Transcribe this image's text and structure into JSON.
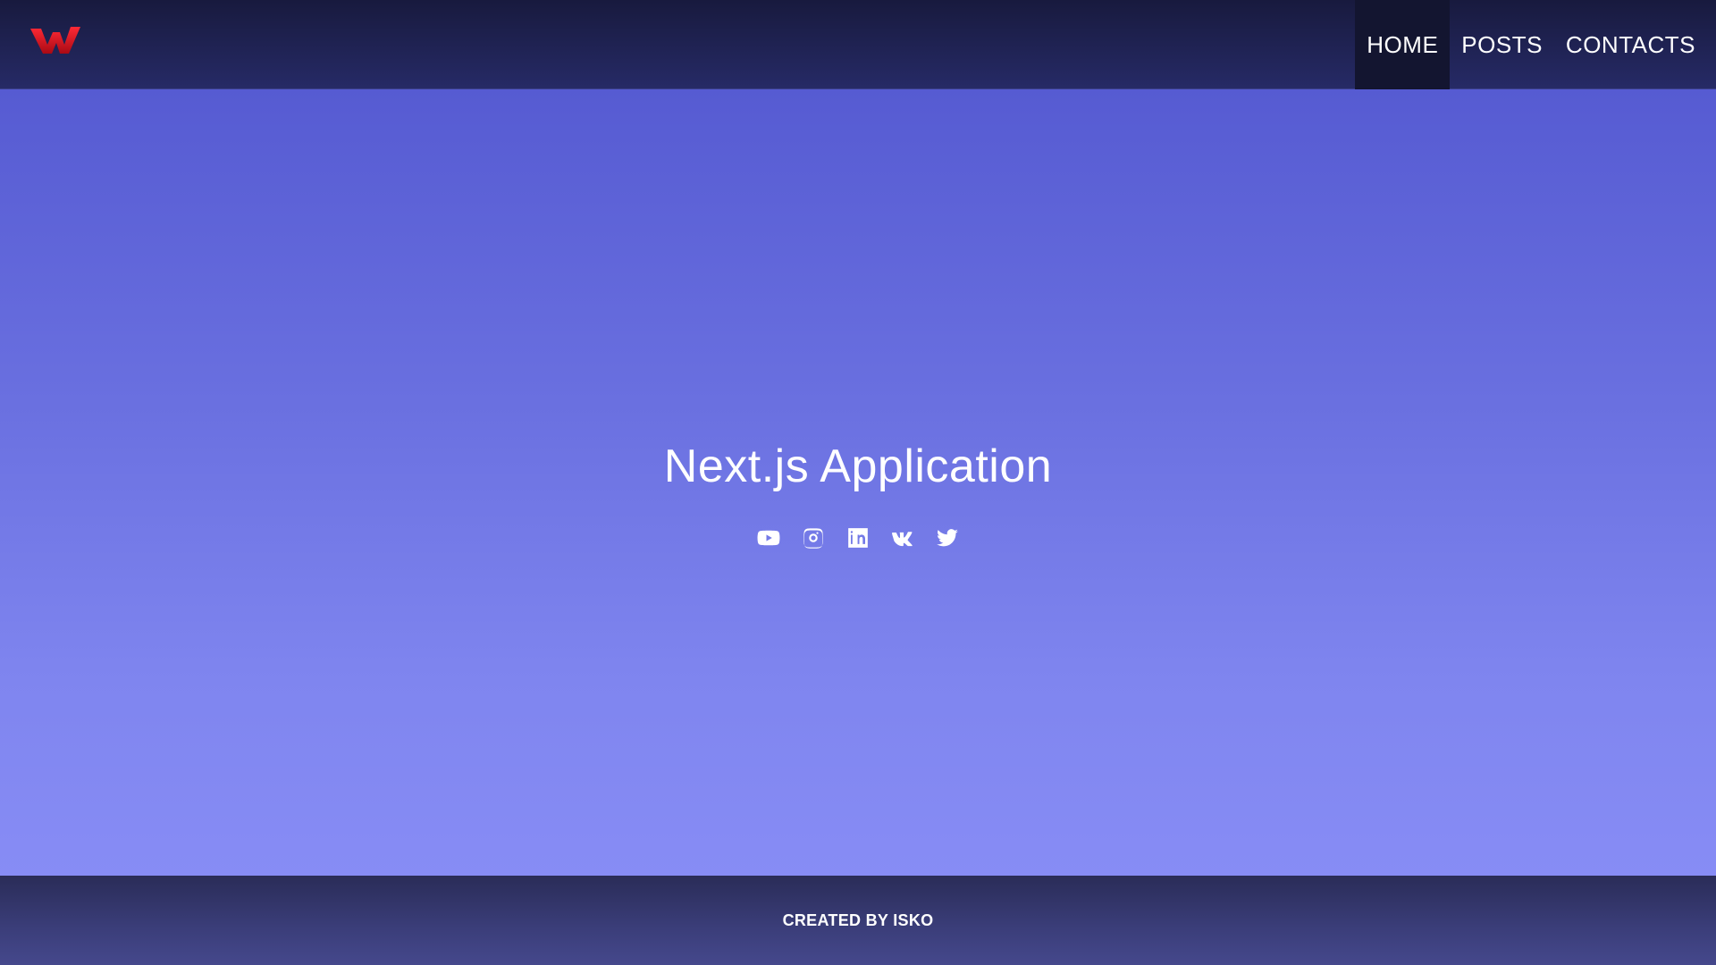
{
  "header": {
    "logo_icon": "w-logo-icon",
    "nav": [
      {
        "label": "HOME",
        "active": true
      },
      {
        "label": "POSTS",
        "active": false
      },
      {
        "label": "CONTACTS",
        "active": false
      }
    ]
  },
  "hero": {
    "title": "Next.js Application",
    "social": [
      {
        "icon": "youtube-icon"
      },
      {
        "icon": "instagram-icon"
      },
      {
        "icon": "linkedin-icon"
      },
      {
        "icon": "vk-icon"
      },
      {
        "icon": "twitter-icon"
      }
    ]
  },
  "footer": {
    "text": "CREATED BY ISKO"
  },
  "colors": {
    "header_bg": "#1e2150",
    "active_nav_bg": "#131530",
    "main_top": "#565bd2",
    "main_bottom": "#878cf5",
    "footer_bg": "#3b3e7a",
    "logo": "#d4141e"
  }
}
